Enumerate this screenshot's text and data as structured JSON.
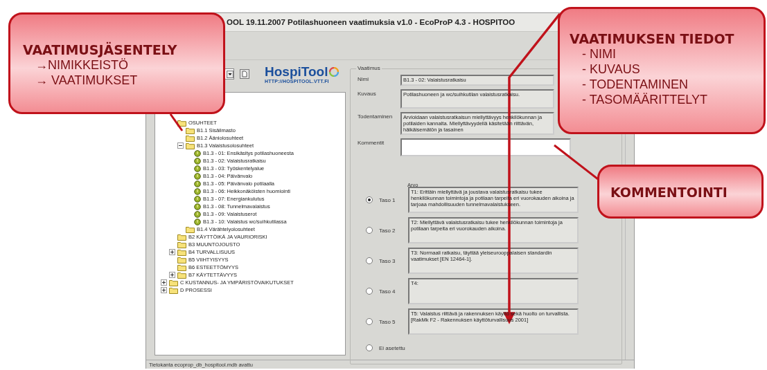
{
  "window": {
    "title": "OOL 19.11.2007 Potilashuoneen vaatimuksia v1.0 - EcoProP 4.3 - HOSPITOO"
  },
  "logo": {
    "name": "HospiTool",
    "url": "HTTP://HOSPITOOL.VTT.FI"
  },
  "tree": {
    "items": [
      {
        "label": "OSUHTEET",
        "kind": "folder",
        "children": [
          {
            "label": "B1.1 Sisäilmasto",
            "kind": "folder"
          },
          {
            "label": "B1.2 Ääniolosuhteet",
            "kind": "folder"
          },
          {
            "label": "B1.3 Valaistusolosuhteet",
            "kind": "folder",
            "expanded": true,
            "children": [
              {
                "label": "B1.3 - 01: Ensikäsitys potilashuoneesta",
                "kind": "bulb"
              },
              {
                "label": "B1.3 - 02: Valaistusratkaisu",
                "kind": "bulb"
              },
              {
                "label": "B1.3 - 03: Työskentelyalue",
                "kind": "bulb"
              },
              {
                "label": "B1.3 - 04: Päivänvalo",
                "kind": "bulb"
              },
              {
                "label": "B1.3 - 05: Päivänvalo potilaalla",
                "kind": "bulb"
              },
              {
                "label": "B1.3 - 06: Heikkonäköisten huomiointi",
                "kind": "bulb"
              },
              {
                "label": "B1.3 - 07: Energiankulutus",
                "kind": "bulb"
              },
              {
                "label": "B1.3 - 08: Tunnelmavalaistus",
                "kind": "bulb"
              },
              {
                "label": "B1.3 - 09: Valaistuserot",
                "kind": "bulb"
              },
              {
                "label": "B1.3 - 10: Valaistus wc/suihkutilassa",
                "kind": "bulb"
              }
            ]
          },
          {
            "label": "B1.4 Värähtelyolosuhteet",
            "kind": "folder"
          }
        ]
      },
      {
        "label": "B2 KÄYTTÖIKÄ JA VAURIORISKI",
        "kind": "folder"
      },
      {
        "label": "B3 MUUNTOJOUSTO",
        "kind": "folder"
      },
      {
        "label": "B4 TURVALLISUUS",
        "kind": "folder",
        "expanded": false
      },
      {
        "label": "B5 VIIHTYISYYS",
        "kind": "folder"
      },
      {
        "label": "B6 ESTEETTÖMYYS",
        "kind": "folder"
      },
      {
        "label": "B7 KÄYTETTÄVYYS",
        "kind": "folder",
        "expanded": false
      }
    ],
    "root_items": [
      {
        "label": "C KUSTANNUS- JA YMPÄRISTÖVAIKUTUKSET",
        "kind": "folder",
        "expanded": false
      },
      {
        "label": "D PROSESSI",
        "kind": "folder",
        "expanded": false
      }
    ]
  },
  "requirement": {
    "group_title": "Vaatimus",
    "fields": [
      {
        "label": "Nimi",
        "value": "B1.3 - 02: Valaistusratkaisu",
        "kind": "single"
      },
      {
        "label": "Kuvaus",
        "value": "Potilashuoneen ja wc/suihkutilan valaistusratkaisu.",
        "kind": "multi"
      },
      {
        "label": "Todentaminen",
        "value": "Arvioidaan valaistusratkaisun miellyttävyys henkilökunnan ja potilaiden kannalta. Miellyttävyydellä käsitetään riittävän, häikäisemätön ja tasainen",
        "kind": "multi"
      },
      {
        "label": "Kommentit",
        "kind": "comment"
      }
    ],
    "levels_title": "Arvo",
    "levels": [
      {
        "label": "Taso 1",
        "text": "T1: Erittäin miellyttävä ja joustava valaistusratkaisu tukee henkilökunnan toimintoja ja potilaan tarpeita eri vuorokauden aikoina ja tarjoaa mahdollisuuden tunnelmavalaistukseen.",
        "selected": true
      },
      {
        "label": "Taso 2",
        "text": "T2: Miellyttävä valaistusratkaisu tukee henkilökunnan toimintoja ja potilaan tarpeita eri vuorokauden aikoina.",
        "selected": false
      },
      {
        "label": "Taso 3",
        "text": "T3: Normaali ratkaisu, täyttää yleiseurooppalaisen standardin vaatimukset [EN 12464-1].",
        "selected": false
      },
      {
        "label": "Taso 4",
        "text": "T4:",
        "selected": false
      },
      {
        "label": "Taso 5",
        "text": "T5: Valaistus riittävä ja rakennuksen käyttö sekä huolto on turvallista. [RakMk F2 - Rakennuksen käyttöturvallisuus 2001]",
        "selected": false
      }
    ],
    "unset": {
      "label": "Ei asetettu",
      "selected": false
    }
  },
  "status_bar": "Tietokanta ecoprop_db_hospitool.mdb avattu",
  "callouts": [
    {
      "title": "VAATIMUSJÄSENTELY",
      "lines": [
        "→NIMIKKEISTÖ",
        "→ VAATIMUKSET"
      ]
    },
    {
      "title": "VAATIMUKSEN TIEDOT",
      "lines": [
        "- NIMI",
        "- KUVAUS",
        "- TODENTAMINEN",
        "- TASOMÄÄRITTELYT"
      ]
    },
    {
      "title": "KOMMENTOINTI"
    }
  ]
}
